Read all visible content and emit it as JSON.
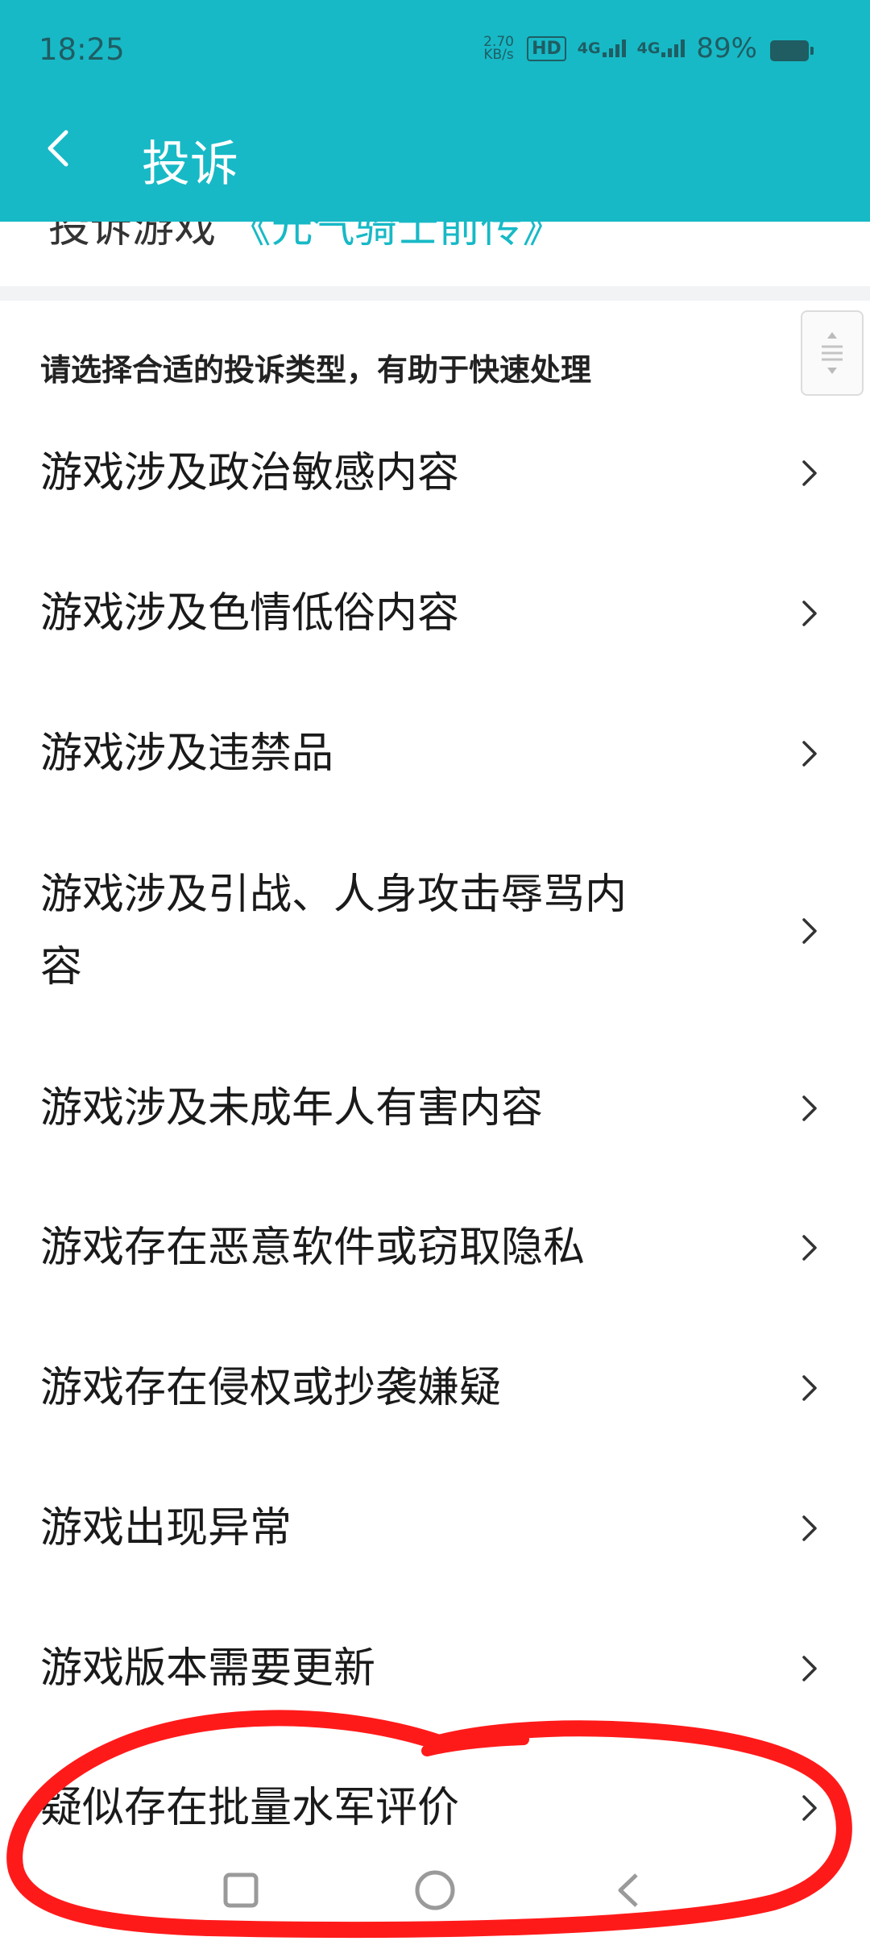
{
  "status_bar": {
    "time": "18:25",
    "net_speed_value": "2.70",
    "net_speed_unit": "KB/s",
    "hd_label": "HD",
    "net_a": "4G",
    "net_b": "4G",
    "battery": "89%"
  },
  "header": {
    "title": "投诉"
  },
  "target": {
    "prefix": "投诉游戏",
    "game": "《元气骑士前传》"
  },
  "hint": "请选择合适的投诉类型，有助于快速处理",
  "items": [
    {
      "label": "游戏涉及政治敏感内容"
    },
    {
      "label": "游戏涉及色情低俗内容"
    },
    {
      "label": "游戏涉及违禁品"
    },
    {
      "label": "游戏涉及引战、人身攻击辱骂内",
      "label2": "容"
    },
    {
      "label": "游戏涉及未成年人有害内容"
    },
    {
      "label": "游戏存在恶意软件或窃取隐私"
    },
    {
      "label": "游戏存在侵权或抄袭嫌疑"
    },
    {
      "label": "游戏出现异常"
    },
    {
      "label": "游戏版本需要更新"
    },
    {
      "label": "疑似存在批量水军评价"
    }
  ],
  "colors": {
    "accent": "#17b9c6",
    "annotation": "#ff1a1a"
  }
}
